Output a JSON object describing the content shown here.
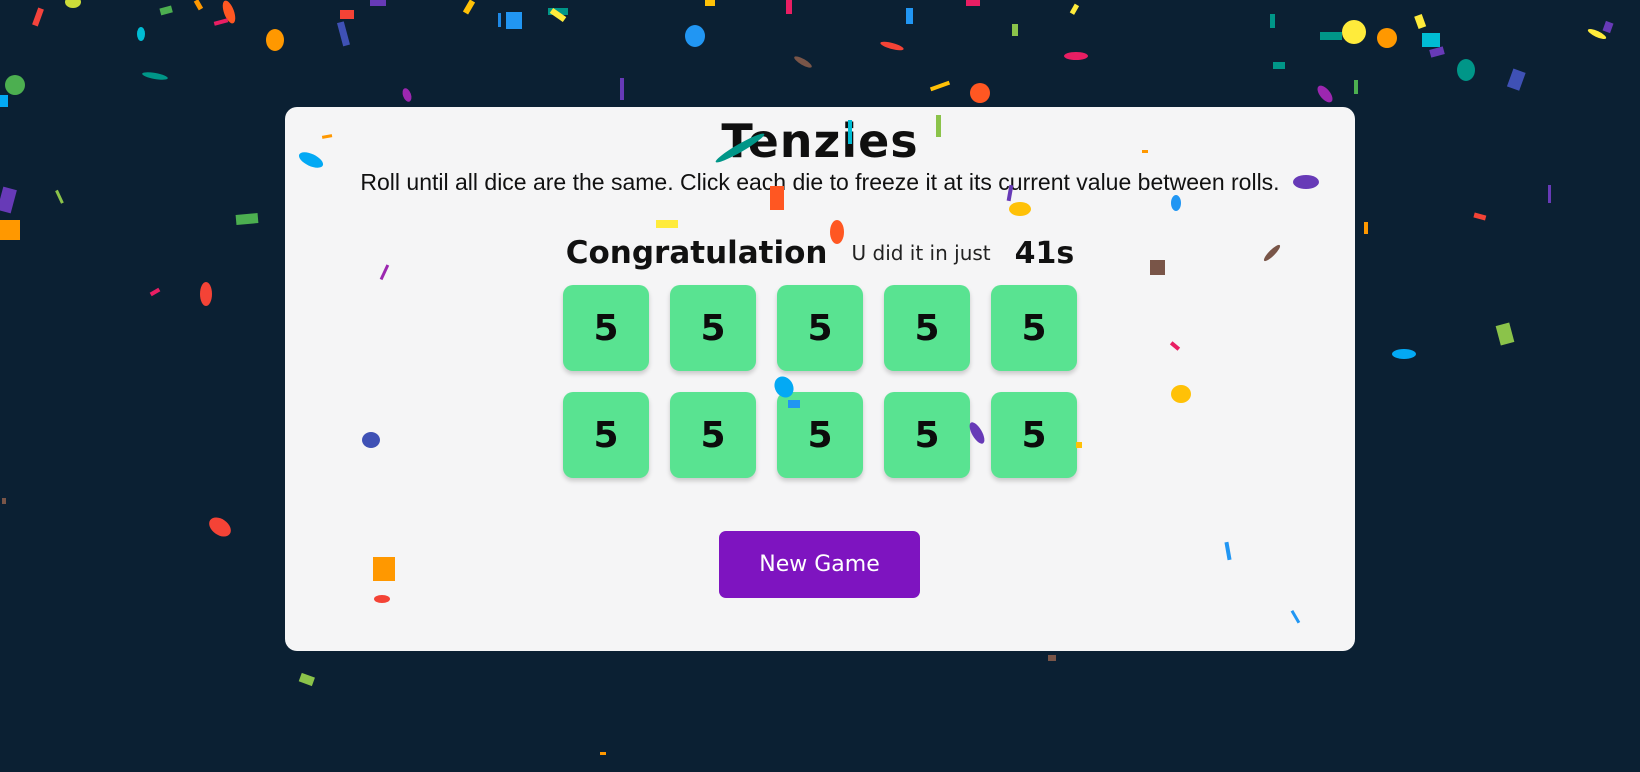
{
  "app": {
    "title": "Tenzies",
    "instructions": "Roll until all dice are the same. Click each die to freeze it at its current value between rolls."
  },
  "status": {
    "congrats": "Congratulation",
    "time_label": "U did it in just",
    "time_value": "41s"
  },
  "dice": [
    {
      "value": "5",
      "held": true
    },
    {
      "value": "5",
      "held": true
    },
    {
      "value": "5",
      "held": true
    },
    {
      "value": "5",
      "held": true
    },
    {
      "value": "5",
      "held": true
    },
    {
      "value": "5",
      "held": true
    },
    {
      "value": "5",
      "held": true
    },
    {
      "value": "5",
      "held": true
    },
    {
      "value": "5",
      "held": true
    },
    {
      "value": "5",
      "held": true
    }
  ],
  "controls": {
    "new_game_label": "New Game"
  },
  "colors": {
    "background": "#0b2033",
    "card": "#f5f5f6",
    "die_held": "#59e391",
    "button": "#7e14c0"
  }
}
